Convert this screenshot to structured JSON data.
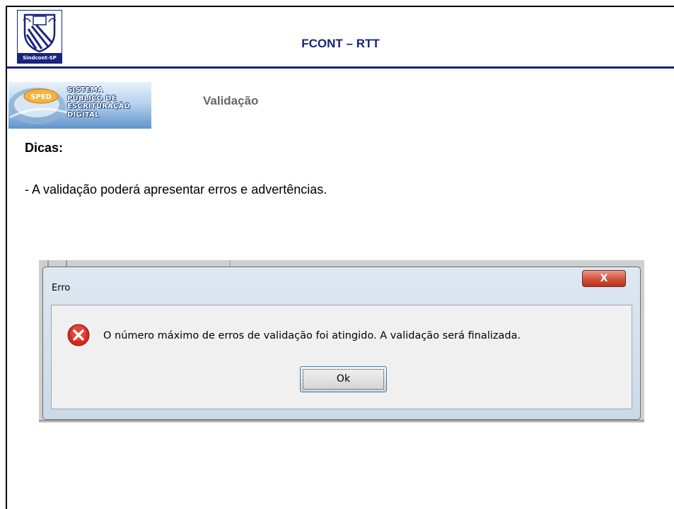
{
  "header": {
    "logo_caption": "Sindcont-SP",
    "title": "FCONT – RTT"
  },
  "sped_banner": {
    "badge": "SPED",
    "lines": [
      "SISTEMA",
      "PÚBLICO DE",
      "ESCRITURAÇÃO",
      "DIGITAL"
    ]
  },
  "section": {
    "title": "Validação"
  },
  "tips": {
    "heading": "Dicas:",
    "line": "- A validação poderá apresentar erros e advertências."
  },
  "dialog": {
    "title": "Erro",
    "close_label": "X",
    "message": "O número máximo de erros de validação foi atingido. A validação será finalizada.",
    "ok_label": "Ok",
    "icon": "error-icon"
  },
  "colors": {
    "brand_navy": "#14237a",
    "section_gray": "#666666",
    "close_red": "#d2553f"
  }
}
